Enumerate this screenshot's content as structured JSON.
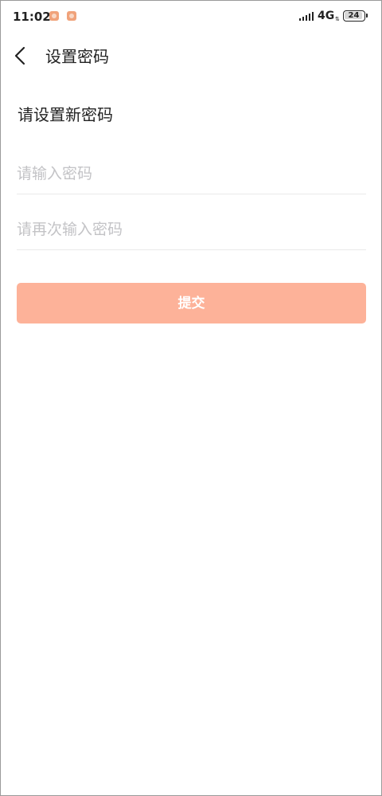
{
  "status_bar": {
    "time": "11:02",
    "network": "4G",
    "battery": "24",
    "battery_fraction": 0.24
  },
  "header": {
    "title": "设置密码"
  },
  "form": {
    "section_title": "请设置新密码",
    "password_placeholder": "请输入密码",
    "confirm_placeholder": "请再次输入密码",
    "submit_label": "提交"
  },
  "colors": {
    "accent": "#fdb299",
    "notification": "#f0a27a"
  }
}
